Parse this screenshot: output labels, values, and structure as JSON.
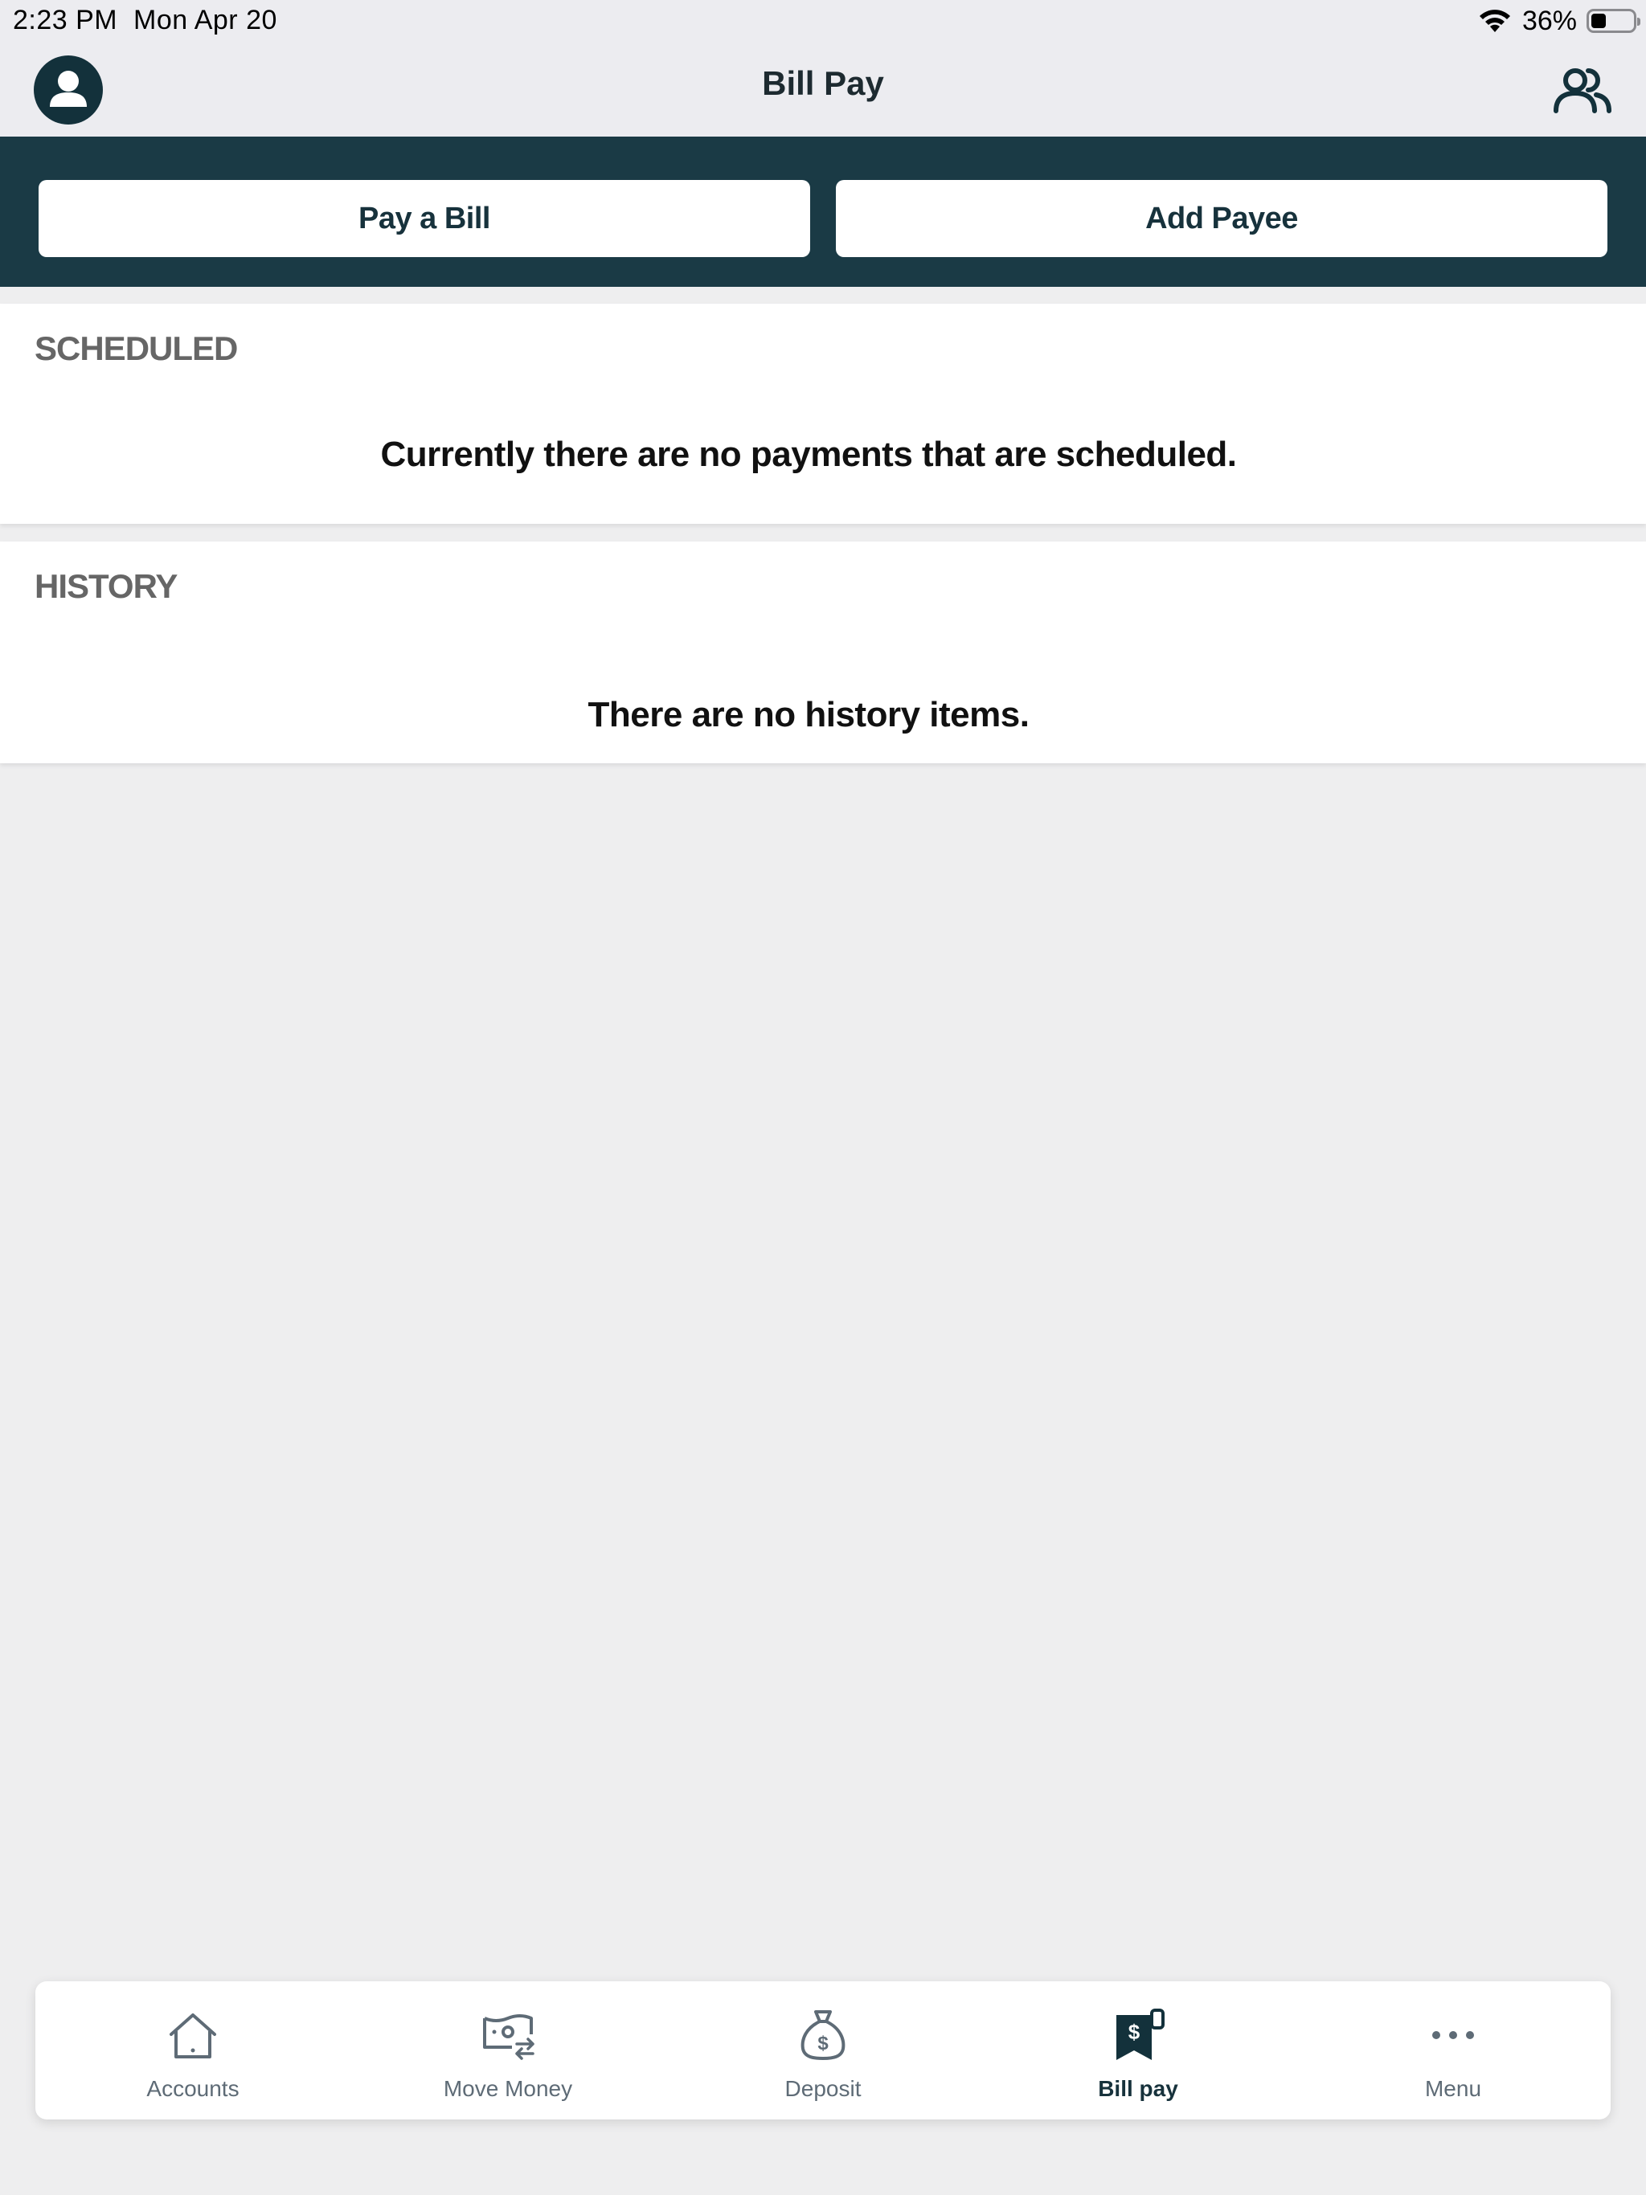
{
  "status_bar": {
    "time": "2:23 PM",
    "date": "Mon Apr 20",
    "battery_percent": "36%",
    "battery_level": 0.36
  },
  "nav": {
    "title": "Bill Pay",
    "left_icon": "profile-icon",
    "right_icon": "payees-icon"
  },
  "actions": {
    "pay_bill_label": "Pay a Bill",
    "add_payee_label": "Add Payee"
  },
  "scheduled": {
    "heading": "SCHEDULED",
    "empty_message": "Currently there are no payments that are scheduled."
  },
  "history": {
    "heading": "HISTORY",
    "empty_message": "There are no history items."
  },
  "tabs": [
    {
      "label": "Accounts",
      "icon": "home-icon",
      "active": false
    },
    {
      "label": "Move Money",
      "icon": "move-money-icon",
      "active": false
    },
    {
      "label": "Deposit",
      "icon": "money-bag-icon",
      "active": false
    },
    {
      "label": "Bill pay",
      "icon": "bill-icon",
      "active": true
    },
    {
      "label": "Menu",
      "icon": "more-icon",
      "active": false
    }
  ],
  "colors": {
    "brand_dark": "#1a3a45",
    "active_tab": "#17323c",
    "inactive_tab": "#5e6b76",
    "background": "#eeeeef"
  }
}
